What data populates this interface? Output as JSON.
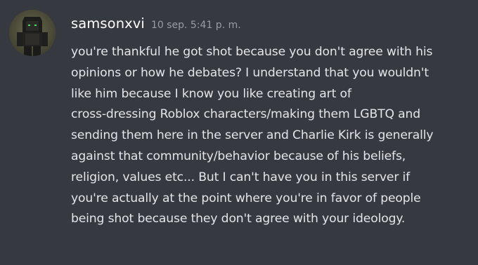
{
  "message": {
    "avatar_icon": "roblox-avatar-icon",
    "username": "samsonxvi",
    "timestamp": "10 sep. 5:41 p. m.",
    "lines": [
      "you're thankful he got shot because you don't agree with his",
      "opinions or how he debates? I understand that you wouldn't",
      "like him because I know you like creating art of",
      "cross-dressing Roblox characters/making them LGBTQ and",
      "sending them here in the server and Charlie Kirk is generally",
      "against that community/behavior because of his beliefs,",
      "religion, values etc... But I can't have you in this server if",
      "you're actually at the point where you're in favor of people",
      "being shot because they don't agree with your ideology."
    ]
  },
  "colors": {
    "background": "#36393f",
    "username": "#ffffff",
    "timestamp": "#9a9ca3",
    "text": "#e4e5e8"
  }
}
